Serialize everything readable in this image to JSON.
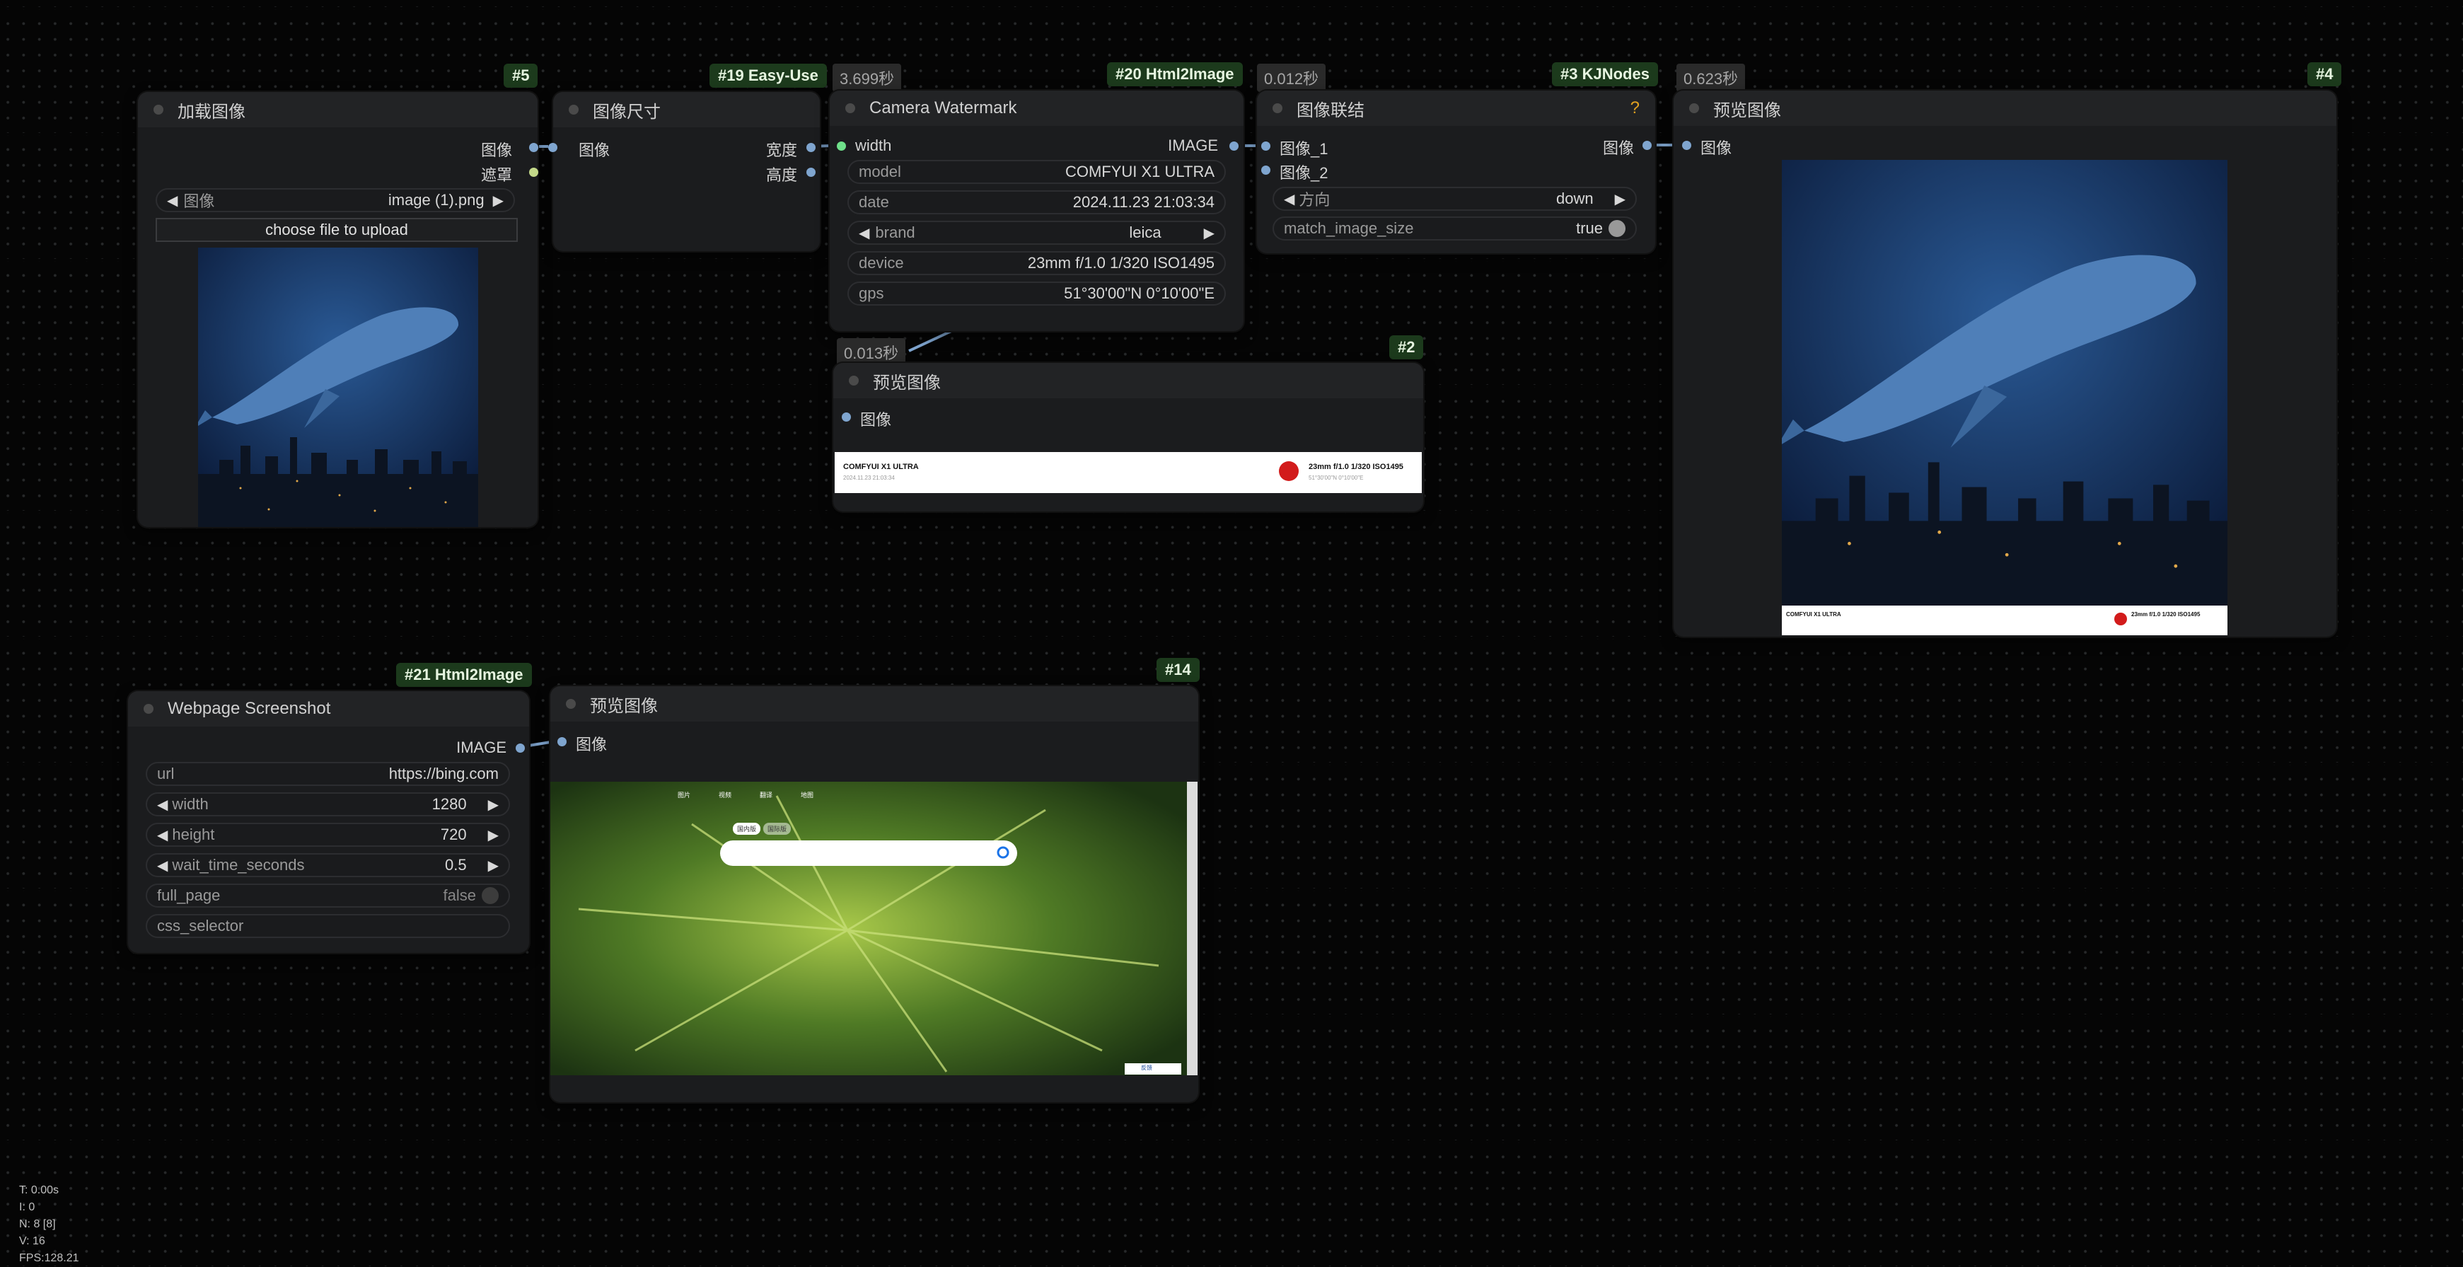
{
  "nodes": {
    "load_image": {
      "id": "#5",
      "title": "加载图像",
      "out_image": "图像",
      "out_mask": "遮罩",
      "image_label": "图像",
      "image_value": "image (1).png",
      "upload": "choose file to upload"
    },
    "image_size": {
      "id": "#19 Easy-Use",
      "title": "图像尺寸",
      "in_image": "图像",
      "out_width": "宽度",
      "out_height": "高度"
    },
    "watermark": {
      "time": "3.699秒",
      "id": "#20 Html2Image",
      "title": "Camera Watermark",
      "in_width": "width",
      "out": "IMAGE",
      "fields": [
        {
          "k": "model",
          "v": "COMFYUI X1 ULTRA"
        },
        {
          "k": "date",
          "v": "2024.11.23 21:03:34"
        },
        {
          "k": "brand",
          "v": "leica"
        },
        {
          "k": "device",
          "v": "23mm f/1.0 1/320 ISO1495"
        },
        {
          "k": "gps",
          "v": "51°30'00\"N 0°10'00\"E"
        }
      ]
    },
    "concat": {
      "time": "0.012秒",
      "id": "#3 KJNodes",
      "title": "图像联结",
      "help": "?",
      "in1": "图像_1",
      "in2": "图像_2",
      "out": "图像",
      "dir_label": "方向",
      "dir_value": "down",
      "match_label": "match_image_size",
      "match_value": "true"
    },
    "preview4": {
      "time": "0.623秒",
      "id": "#4",
      "title": "预览图像",
      "in": "图像",
      "strip_left": "COMFYUI X1 ULTRA",
      "strip_right": "23mm f/1.0 1/320 ISO1495"
    },
    "preview2": {
      "time": "0.013秒",
      "id": "#2",
      "title": "预览图像",
      "in": "图像",
      "strip_left": "COMFYUI X1 ULTRA",
      "strip_sub": "2024.11.23 21:03:34",
      "strip_right": "23mm f/1.0 1/320 ISO1495",
      "strip_sub2": "51°30'00\"N 0°10'00\"E"
    },
    "webshot": {
      "id": "#21 Html2Image",
      "title": "Webpage Screenshot",
      "out": "IMAGE",
      "fields": [
        {
          "k": "url",
          "v": "https://bing.com"
        },
        {
          "k": "width",
          "v": "1280"
        },
        {
          "k": "height",
          "v": "720"
        },
        {
          "k": "wait_time_seconds",
          "v": "0.5"
        },
        {
          "k": "full_page",
          "v": "false"
        },
        {
          "k": "css_selector",
          "v": ""
        }
      ]
    },
    "preview14": {
      "id": "#14",
      "title": "预览图像",
      "in": "图像",
      "bing_tabs": [
        "图片",
        "视频",
        "翻译",
        "地图"
      ],
      "bing_pills": [
        "国内版",
        "国际版"
      ],
      "bing_corner": "反馈"
    }
  },
  "stats": [
    "T: 0.00s",
    "I: 0",
    "N: 8 [8]",
    "V: 16",
    "FPS:128.21"
  ],
  "colors": {
    "background": "#050505",
    "node": "#1b1c1e",
    "badge": "#1c3a1c",
    "socket": "#7fa5cf",
    "link": "#7fa5cf"
  }
}
